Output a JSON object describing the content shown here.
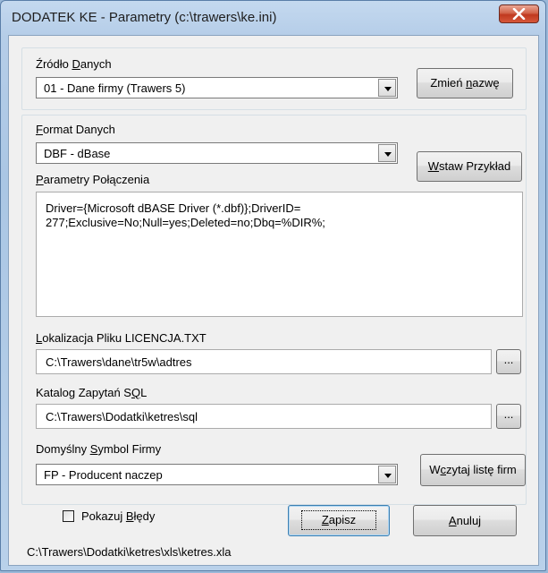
{
  "window": {
    "title": "DODATEK KE - Parametry (c:\\trawers\\ke.ini)"
  },
  "source": {
    "label_pre": "Źródło ",
    "label_u": "D",
    "label_post": "anych",
    "value": "01 - Dane firmy (Trawers 5)",
    "rename_pre": "Zmień ",
    "rename_u": "n",
    "rename_post": "azwę"
  },
  "format": {
    "label_u": "F",
    "label_post": "ormat Danych",
    "value": "DBF - dBase",
    "insert_u": "W",
    "insert_post": "staw Przykład"
  },
  "connection": {
    "label_u": "P",
    "label_post": "arametry Połączenia",
    "value": "Driver={Microsoft dBASE Driver (*.dbf)};DriverID=\n277;Exclusive=No;Null=yes;Deleted=no;Dbq=%DIR%;"
  },
  "license": {
    "label_u": "L",
    "label_post": "okalizacja Pliku LICENCJA.TXT",
    "value": "C:\\Trawers\\dane\\tr5w\\adtres",
    "browse": "..."
  },
  "sql": {
    "label_pre": "Katalog Zapytań S",
    "label_u": "Q",
    "label_post": "L",
    "value": "C:\\Trawers\\Dodatki\\ketres\\sql",
    "browse": "..."
  },
  "company": {
    "label_pre": "Domyślny ",
    "label_u": "S",
    "label_post": "ymbol Firmy",
    "value": "FP - Producent naczep",
    "load_pre": "W",
    "load_u": "c",
    "load_post": "zytaj listę firm"
  },
  "footer": {
    "show_errors_pre": "Pokazuj ",
    "show_errors_u": "B",
    "show_errors_post": "łędy",
    "save_u": "Z",
    "save_post": "apisz",
    "cancel_u": "A",
    "cancel_post": "nuluj",
    "path": "C:\\Trawers\\Dodatki\\ketres\\xls\\ketres.xla"
  }
}
